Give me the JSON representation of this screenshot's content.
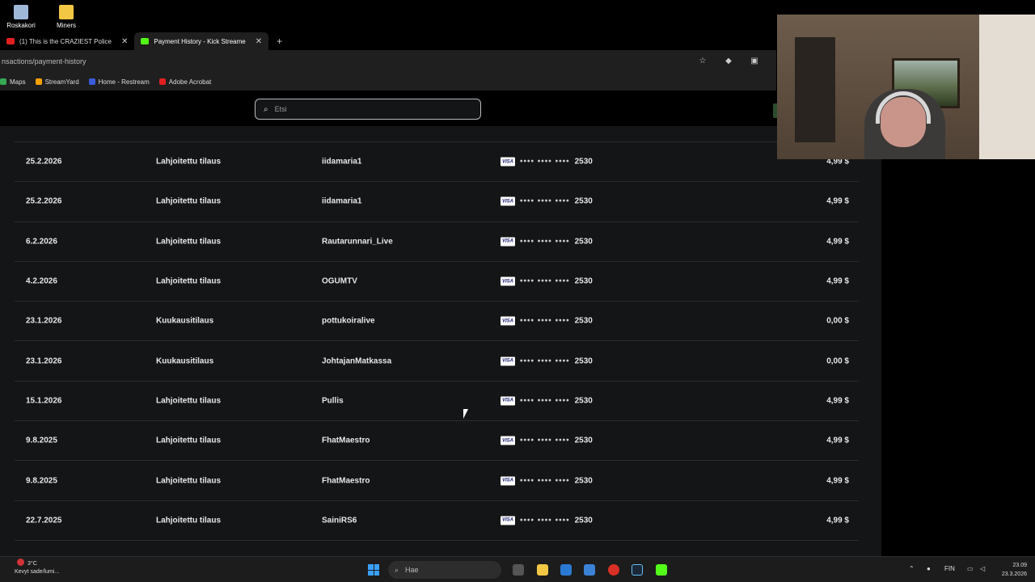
{
  "desktop": {
    "icons": [
      {
        "label": "Roskakori",
        "color": "#9fb8d8"
      },
      {
        "label": "Miners",
        "color": "#f2c744"
      }
    ]
  },
  "browser": {
    "tabs": [
      {
        "title": "(1) This is the CRAZIEST Police",
        "active": false,
        "favicon_color": "#e02020"
      },
      {
        "title": "Payment History - Kick Streame",
        "active": true,
        "favicon_color": "#53fc18"
      }
    ],
    "url": "nsactions/payment-history",
    "bookmarks": [
      {
        "label": "Maps",
        "color": "#34a853"
      },
      {
        "label": "StreamYard",
        "color": "#ffa000"
      },
      {
        "label": "Home - Restream",
        "color": "#3b5bdb"
      },
      {
        "label": "Adobe Acrobat",
        "color": "#e02020"
      }
    ]
  },
  "page": {
    "search_placeholder": "Etsi",
    "rows": [
      {
        "date": "25.2.2026",
        "type": "Lahjoitettu tilaus",
        "user": "iidamaria1",
        "card_last4": "2530",
        "amount": "4,99 $"
      },
      {
        "date": "25.2.2026",
        "type": "Lahjoitettu tilaus",
        "user": "iidamaria1",
        "card_last4": "2530",
        "amount": "4,99 $"
      },
      {
        "date": "6.2.2026",
        "type": "Lahjoitettu tilaus",
        "user": "Rautarunnari_Live",
        "card_last4": "2530",
        "amount": "4,99 $"
      },
      {
        "date": "4.2.2026",
        "type": "Lahjoitettu tilaus",
        "user": "OGUMTV",
        "card_last4": "2530",
        "amount": "4,99 $"
      },
      {
        "date": "23.1.2026",
        "type": "Kuukausitilaus",
        "user": "pottukoiralive",
        "card_last4": "2530",
        "amount": "0,00 $"
      },
      {
        "date": "23.1.2026",
        "type": "Kuukausitilaus",
        "user": "JohtajanMatkassa",
        "card_last4": "2530",
        "amount": "0,00 $"
      },
      {
        "date": "15.1.2026",
        "type": "Lahjoitettu tilaus",
        "user": "Pullis",
        "card_last4": "2530",
        "amount": "4,99 $"
      },
      {
        "date": "9.8.2025",
        "type": "Lahjoitettu tilaus",
        "user": "FhatMaestro",
        "card_last4": "2530",
        "amount": "4,99 $"
      },
      {
        "date": "9.8.2025",
        "type": "Lahjoitettu tilaus",
        "user": "FhatMaestro",
        "card_last4": "2530",
        "amount": "4,99 $"
      },
      {
        "date": "22.7.2025",
        "type": "Lahjoitettu tilaus",
        "user": "SainiRS6",
        "card_last4": "2530",
        "amount": "4,99 $"
      }
    ],
    "card_mask": "•••• •••• ••••",
    "card_brand": "VISA"
  },
  "taskbar": {
    "weather_temp": "3°C",
    "weather_desc": "Kevyt sade/lumi...",
    "search_placeholder": "Hae",
    "language": "FIN",
    "time": "23.09",
    "date": "23.3.2026"
  }
}
